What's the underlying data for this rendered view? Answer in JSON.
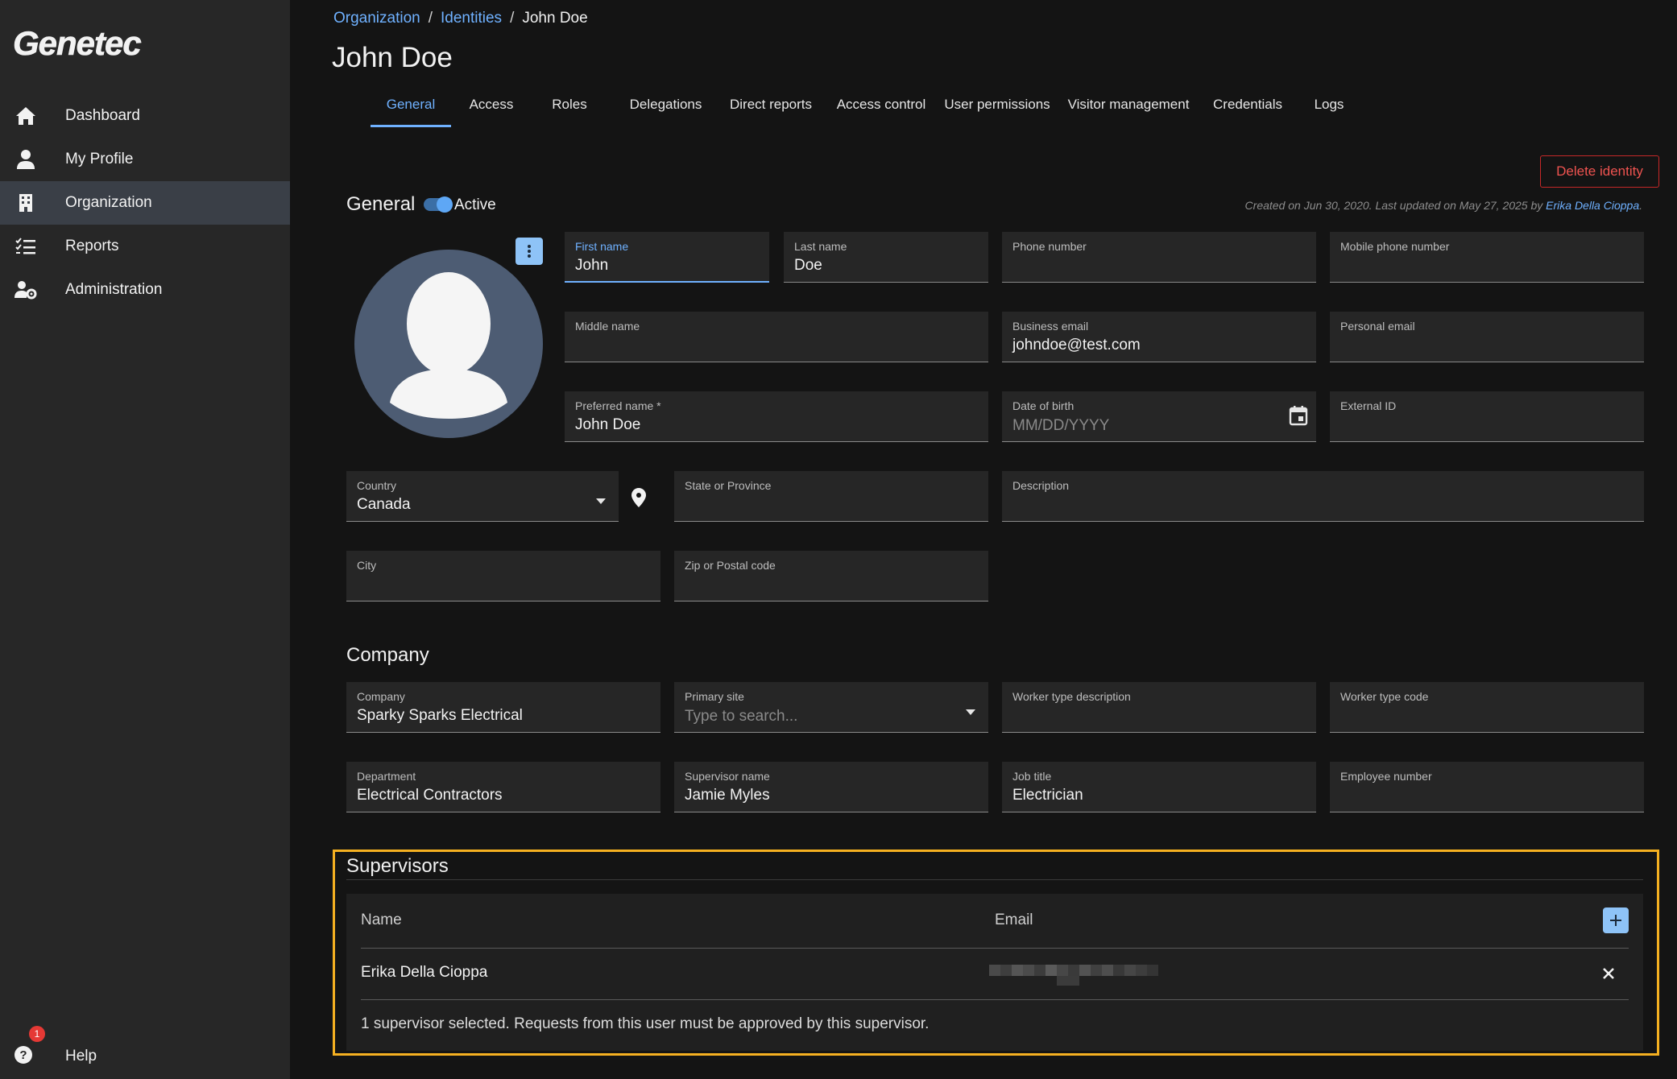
{
  "app": {
    "logo_text": "Genetec"
  },
  "sidebar": {
    "items": [
      {
        "label": "Dashboard",
        "icon": "home-icon"
      },
      {
        "label": "My Profile",
        "icon": "person-icon"
      },
      {
        "label": "Organization",
        "icon": "building-icon",
        "active": true
      },
      {
        "label": "Reports",
        "icon": "checklist-icon"
      },
      {
        "label": "Administration",
        "icon": "user-gear-icon"
      }
    ],
    "help": {
      "label": "Help",
      "badge": "1",
      "icon": "help-icon"
    }
  },
  "breadcrumb": {
    "items": [
      "Organization",
      "Identities"
    ],
    "separator": "/",
    "current": "John Doe"
  },
  "page": {
    "title": "John Doe"
  },
  "tabs": [
    "General",
    "Access",
    "Roles",
    "Delegations",
    "Direct reports",
    "Access control",
    "User permissions",
    "Visitor management",
    "Credentials",
    "Logs"
  ],
  "actions": {
    "delete_label": "Delete identity"
  },
  "general": {
    "title": "General",
    "active_label": "Active",
    "active": true,
    "meta_prefix": "Created on Jun 30, 2020. Last updated on May 27, 2025 by",
    "meta_user": "Erika Della Cioppa",
    "meta_suffix": ".",
    "fields": {
      "first_name": {
        "label": "First name",
        "value": "John"
      },
      "last_name": {
        "label": "Last name",
        "value": "Doe"
      },
      "phone": {
        "label": "Phone number",
        "value": ""
      },
      "mobile": {
        "label": "Mobile phone number",
        "value": ""
      },
      "middle_name": {
        "label": "Middle name",
        "value": ""
      },
      "business_email": {
        "label": "Business email",
        "value": "johndoe@test.com"
      },
      "personal_email": {
        "label": "Personal email",
        "value": ""
      },
      "preferred_name": {
        "label": "Preferred name *",
        "value": "John Doe"
      },
      "dob": {
        "label": "Date of birth",
        "placeholder": "MM/DD/YYYY"
      },
      "external_id": {
        "label": "External ID",
        "value": ""
      },
      "country": {
        "label": "Country",
        "value": "Canada"
      },
      "state": {
        "label": "State or Province",
        "value": ""
      },
      "description": {
        "label": "Description",
        "value": ""
      },
      "city": {
        "label": "City",
        "value": ""
      },
      "zip": {
        "label": "Zip or Postal code",
        "value": ""
      }
    }
  },
  "company": {
    "title": "Company",
    "fields": {
      "company": {
        "label": "Company",
        "value": "Sparky Sparks Electrical"
      },
      "primary_site": {
        "label": "Primary site",
        "placeholder": "Type to search..."
      },
      "worker_type_description": {
        "label": "Worker type description",
        "value": ""
      },
      "worker_type_code": {
        "label": "Worker type code",
        "value": ""
      },
      "department": {
        "label": "Department",
        "value": "Electrical Contractors"
      },
      "supervisor_name": {
        "label": "Supervisor name",
        "value": "Jamie Myles"
      },
      "job_title": {
        "label": "Job title",
        "value": "Electrician"
      },
      "employee_number": {
        "label": "Employee number",
        "value": ""
      }
    }
  },
  "supervisors": {
    "title": "Supervisors",
    "columns": {
      "name": "Name",
      "email": "Email"
    },
    "rows": [
      {
        "name": "Erika Della Cioppa",
        "email_redacted": true
      }
    ],
    "note": "1 supervisor selected. Requests from this user must be approved by this supervisor."
  },
  "colors": {
    "accent": "#6fb1ff",
    "highlight_border": "#f5b021",
    "danger": "#ef5350",
    "sidebar_bg": "#272727"
  }
}
